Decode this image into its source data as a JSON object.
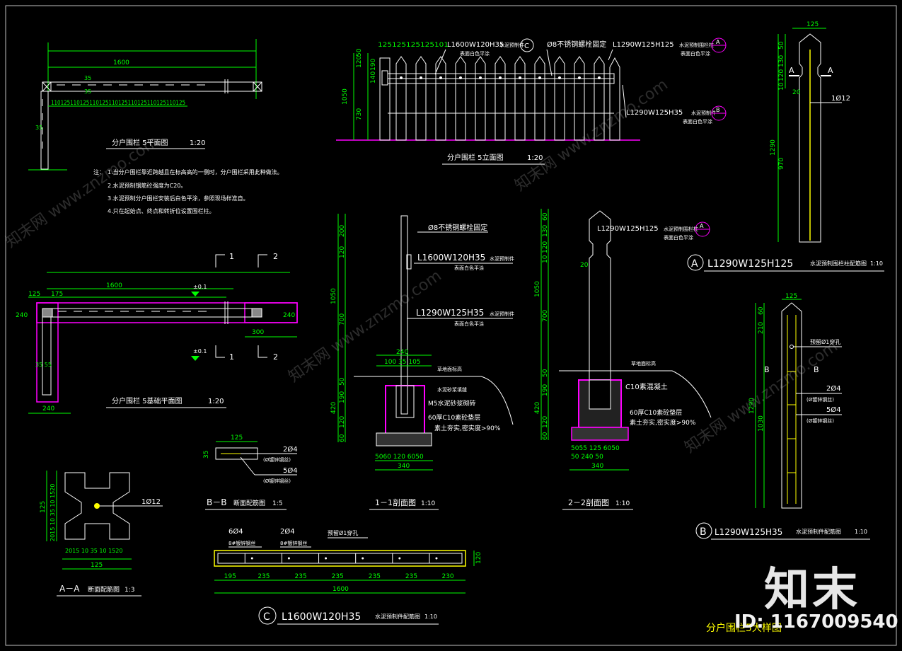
{
  "colors": {
    "background": "#000000",
    "geometry": "#ffffff",
    "dimension": "#00ff00",
    "annotation": "#ffffff",
    "highlight": "#ff00ff",
    "rebar": "#ffff00",
    "frame": "#c0c0c0"
  },
  "plan_view": {
    "title": "分户围栏  5平面图",
    "scale": "1:20",
    "dim_1600": "1600",
    "dim_35a": "35",
    "dim_35b": "35",
    "dim_35c": "35",
    "bottom_dims": "110125110125110125110125110125110125110125"
  },
  "notes": {
    "label": "注：",
    "items": [
      "1.当分户围栏靠近跨越且在标高高的一侧时，分户围栏采用此种做法。",
      "2.水泥预制钢筋砼强度为C20。",
      "3.水泥预制分户围栏安装后白色平涂，参照现场样准自。",
      "4.只在起始点、终点和转折位设置围栏柱。"
    ]
  },
  "foundation_plan": {
    "title": "分户围栏  5基础平面图",
    "scale": "1:20",
    "dim_125": "125",
    "dim_175": "175",
    "dim_1600": "1600",
    "dim_240a": "240",
    "dim_240b": "240",
    "dim_240c": "240",
    "dim_300": "300",
    "dim_35_55": "35 55",
    "level_a": "±0.1",
    "level_b": "±0.1",
    "sec1_top": "1",
    "sec1_bot": "1",
    "sec2_top": "2",
    "sec2_bot": "2"
  },
  "elevation": {
    "title": "分户围栏  5立面图",
    "scale": "1:20",
    "top_dims": "125125125125101",
    "dim_1050": "1050",
    "dim_730": "730",
    "dim_140": "140",
    "dim_190": "190",
    "dim_120": "120",
    "dim_50": "50",
    "callout_rail": "L1600W120H35",
    "callout_rail_sub": "水泥预制件",
    "callout_rail_note": "表面白色平涂",
    "callout_rail_circle": "C",
    "callout_bolt": "Ø8不锈钢螺栓固定",
    "callout_post": "L1290W125H125",
    "callout_post_sub": "水泥预制围栏柱",
    "callout_post_note": "表面白色平涂",
    "callout_post_circle": "A",
    "callout_picket": "L1290W125H35",
    "callout_picket_sub": "水泥预制件",
    "callout_picket_note": "表面白色平涂",
    "callout_picket_circle": "B"
  },
  "post_detail": {
    "dim_125": "125",
    "dim_50": "50",
    "dim_130": "130",
    "dim_120": "120",
    "dim_10": "10",
    "dim_1290": "1290",
    "dim_970": "970",
    "dim_20": "20",
    "rebar": "1Ø12",
    "sec_a_left": "A",
    "sec_a_right": "A",
    "title_circle": "A",
    "title": "L1290W125H125",
    "title_sub": "水泥预制围栏柱配筋图",
    "scale": "1:10"
  },
  "section1": {
    "title": "1－1剖面图",
    "scale": "1:10",
    "dim_200": "200",
    "dim_120": "120",
    "dim_1050": "1050",
    "dim_700": "700",
    "dim_50": "50",
    "dim_190": "190",
    "dim_420": "420",
    "dim_120b": "120",
    "dim_60": "60",
    "dim_240": "240",
    "dim_100_35_105": "100 35 105",
    "bottom_dims": "5060  120  6050",
    "dim_340": "340",
    "bolt": "Ø8不锈钢螺栓固定",
    "rail": "L1600W120H35",
    "rail_sub": "水泥预制件",
    "rail_note": "表面白色平涂",
    "picket": "L1290W125H35",
    "picket_sub": "水泥预制件",
    "picket_note": "表面白色平涂",
    "ground": "草地面标高",
    "mortar1": "水泥砂浆填缝",
    "mortar2": "M5水泥砂浆砌砖",
    "base": "60厚C10素砼垫层",
    "soil": "素土夯实,密实度>90%"
  },
  "section2": {
    "title": "2－2剖面图",
    "scale": "1:10",
    "dim_60": "60",
    "dim_130": "130",
    "dim_120": "120",
    "dim_10": "10",
    "dim_1050": "1050",
    "dim_700": "700",
    "dim_50": "50",
    "dim_190": "190",
    "dim_420": "420",
    "dim_120b": "120",
    "dim_60b": "60",
    "dim_20": "20",
    "post": "L1290W125H125",
    "post_sub": "水泥预制围栏柱",
    "post_note": "表面白色平涂",
    "post_circle": "A",
    "ground": "草地面标高",
    "concrete": "C10素混凝土",
    "base": "60厚C10素砼垫层",
    "soil": "素土夯实,密实度>90%",
    "dims_row1": "5055  125  6050",
    "dims_row2": "50    240    50",
    "dim_340": "340"
  },
  "picket_detail": {
    "dim_125": "125",
    "dim_60": "60",
    "dim_210": "210",
    "dim_1290": "1290",
    "dim_1030": "1030",
    "hole": "预留Ø1穿孔",
    "rebar1": "2Ø4",
    "rebar1_sub": "(Ø镀锌钢丝)",
    "rebar2": "5Ø4",
    "rebar2_sub": "(Ø镀锌钢丝)",
    "sec_b_left": "B",
    "sec_b_right": "B",
    "title_circle": "B",
    "title": "L1290W125H35",
    "title_sub": "水泥预制件配筋图",
    "scale": "1:10"
  },
  "section_aa": {
    "title": "A－A",
    "title_sub": "断面配筋图",
    "scale": "1:3",
    "rebar": "1Ø12",
    "dim_125": "125",
    "bottom_dims": "2015 10 35 10 1520",
    "left_dims": "2015 10 35 10 1520"
  },
  "section_bb": {
    "title": "B－B",
    "title_sub": "断面配筋图",
    "scale": "1:5",
    "dim_125": "125",
    "dim_35": "35",
    "rebar1": "2Ø4",
    "rebar1_sub": "(Ø镀锌钢丝)",
    "rebar2": "5Ø4",
    "rebar2_sub": "(Ø镀锌钢丝)"
  },
  "rail_detail": {
    "label_6d4": "6Ø4",
    "label_6d4_sub": "8#镀锌钢丝",
    "label_2d4": "2Ø4",
    "label_2d4_sub": "8#镀锌钢丝",
    "hole": "预留Ø1穿孔",
    "dims": [
      "195",
      "235",
      "235",
      "235",
      "235",
      "235",
      "230"
    ],
    "dim_1600": "1600",
    "dim_120": "120",
    "title_circle": "C",
    "title": "L1600W120H35",
    "title_sub": "水泥预制件配筋图",
    "scale": "1:10"
  },
  "sheet_title": "分户围栏5大样图",
  "watermark": {
    "logo": "知末",
    "id": "ID: 1167009540",
    "tile_text": "知末网 www.znzmo.com"
  }
}
